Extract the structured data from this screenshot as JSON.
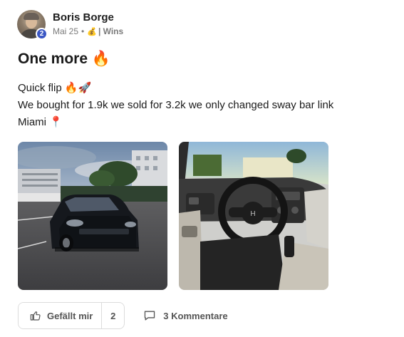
{
  "post": {
    "author": "Boris Borge",
    "level": "2",
    "date": "Mai 25",
    "separator": "•",
    "category_icon": "💰",
    "category": "| Wins",
    "title": "One more 🔥",
    "lines": [
      "Quick flip 🔥🚀",
      "We bought for 1.9k we sold for 3.2k we only changed sway bar link",
      "Miami 📍"
    ],
    "images": [
      {
        "name": "photo-car-exterior"
      },
      {
        "name": "photo-car-interior"
      }
    ]
  },
  "actions": {
    "like_label": "Gefällt mir",
    "like_count": "2",
    "comments_label": "3 Kommentare"
  }
}
